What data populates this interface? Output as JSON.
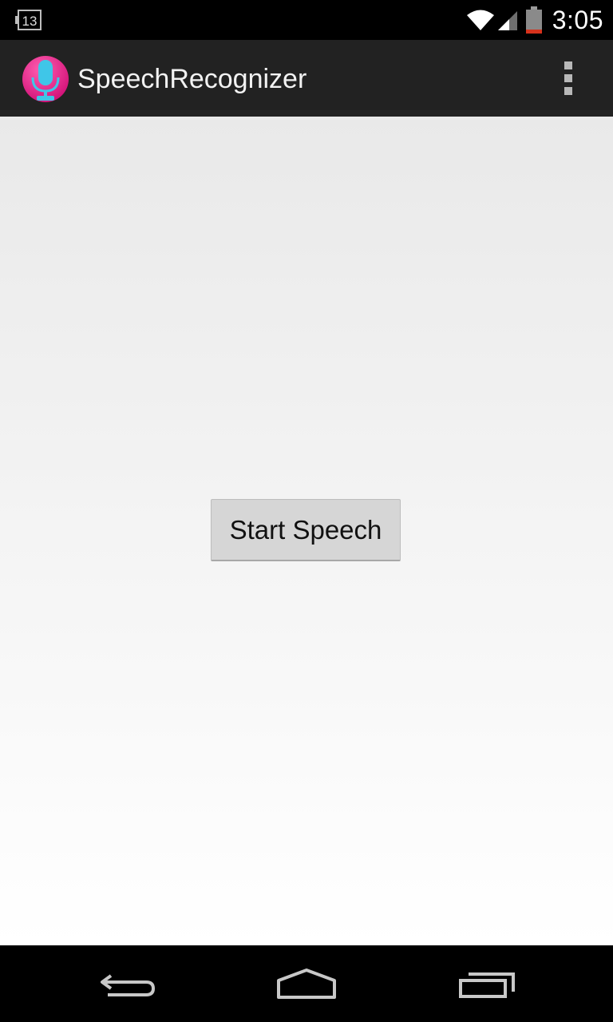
{
  "status_bar": {
    "notification_count": "13",
    "time": "3:05",
    "icons": [
      "notification-count-icon",
      "wifi-icon",
      "signal-icon",
      "battery-icon"
    ]
  },
  "action_bar": {
    "app_icon": "microphone-icon",
    "title": "SpeechRecognizer",
    "overflow_icon": "overflow-menu-icon"
  },
  "main": {
    "start_button_label": "Start Speech"
  },
  "nav_bar": {
    "icons": [
      "back-icon",
      "home-icon",
      "recents-icon"
    ]
  },
  "colors": {
    "status_bar_bg": "#000000",
    "action_bar_bg": "#222222",
    "app_icon_pink": "#ec1e8c",
    "app_icon_cyan": "#3fc6e8",
    "battery_low": "#d6321c",
    "button_bg": "#d6d6d6"
  }
}
